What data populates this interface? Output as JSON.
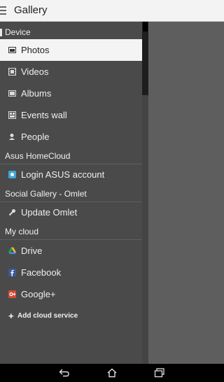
{
  "app": {
    "title": "Gallery"
  },
  "sections": {
    "device": {
      "header": "Device",
      "items": [
        "Photos",
        "Videos",
        "Albums",
        "Events wall",
        "People"
      ]
    },
    "homecloud": {
      "header": "Asus HomeCloud",
      "items": [
        "Login ASUS account"
      ]
    },
    "omlet": {
      "header": "Social Gallery - Omlet",
      "items": [
        "Update Omlet"
      ]
    },
    "mycloud": {
      "header": "My cloud",
      "items": [
        "Drive",
        "Facebook",
        "Google+"
      ],
      "add_label": "Add cloud service"
    }
  },
  "selected_item": "Photos",
  "colors": {
    "drawer_bg": "#4a4a4a",
    "selected_bg": "#f4f4f4",
    "content_bg": "#5e5e5e"
  }
}
